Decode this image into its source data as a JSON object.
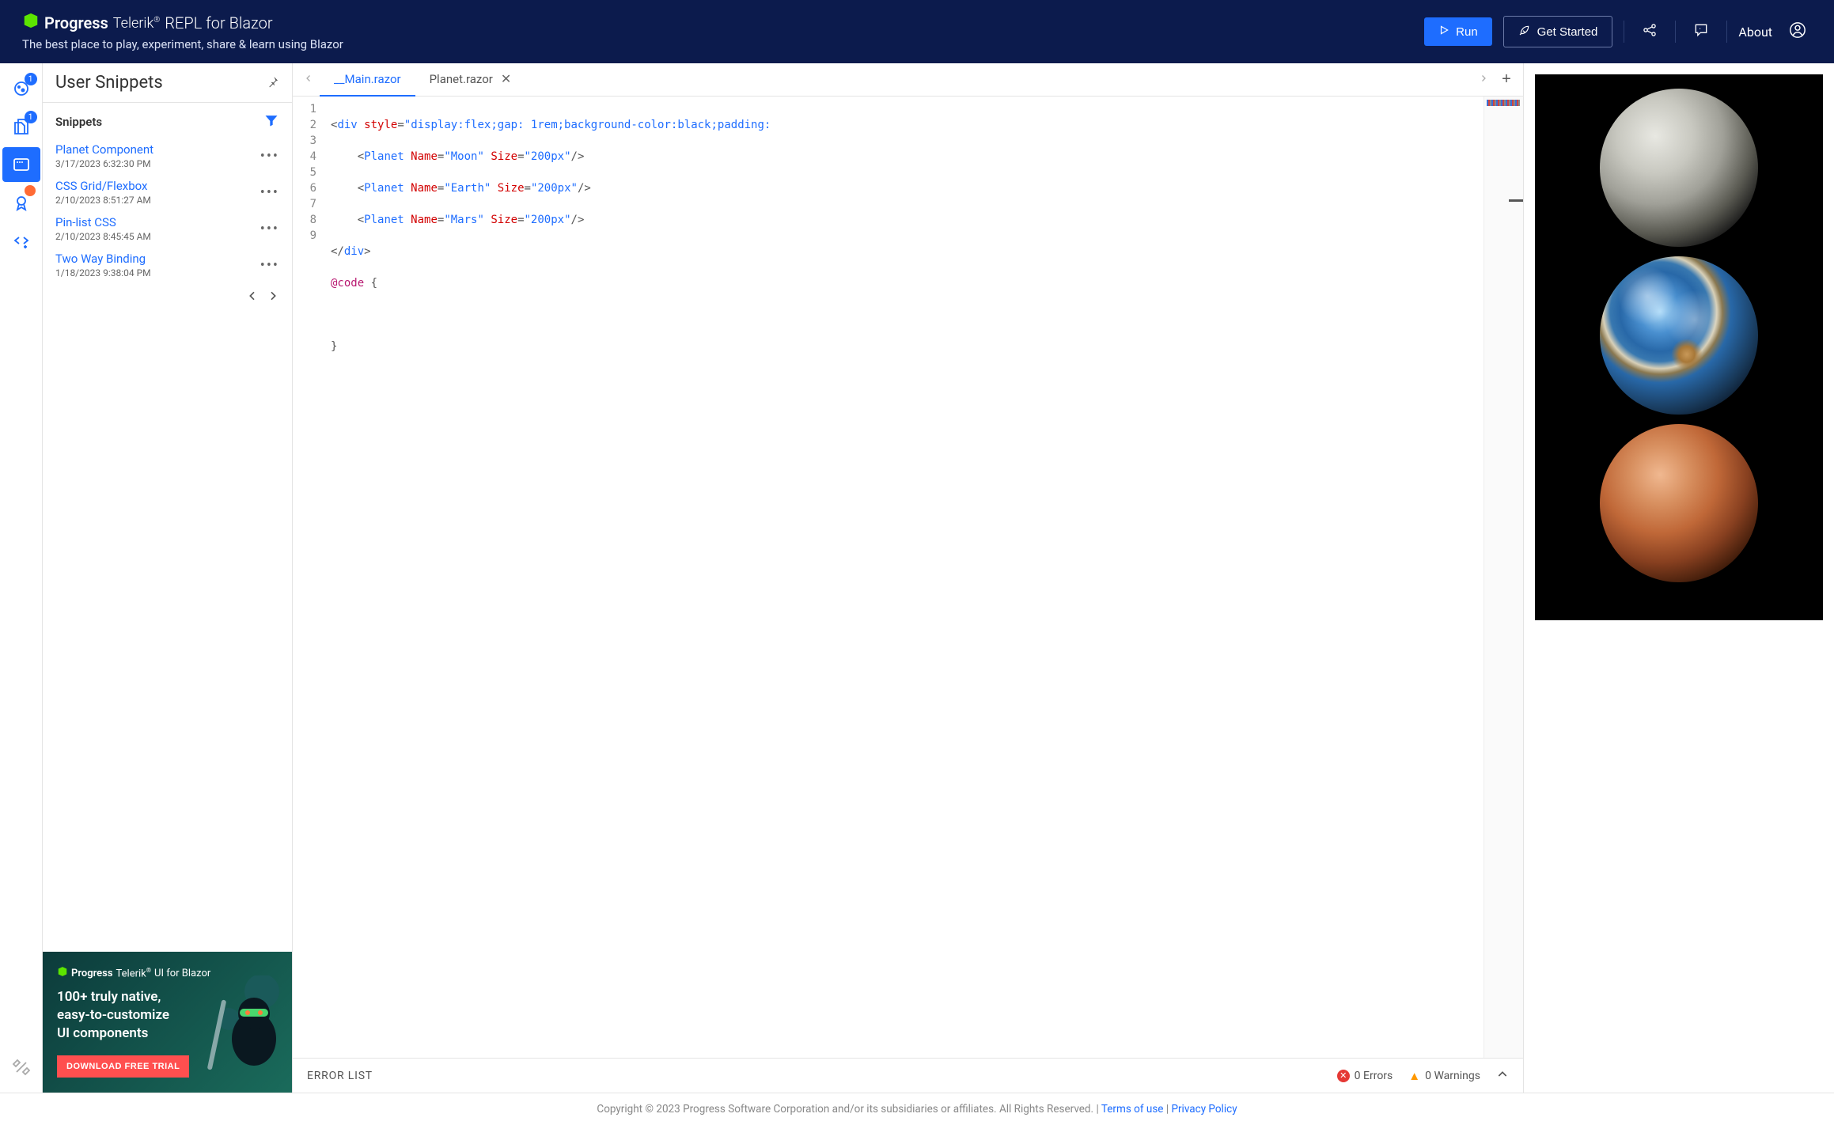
{
  "header": {
    "brand_progress": "Progress",
    "brand_telerik": "Telerik",
    "brand_suffix": "REPL for Blazor",
    "tagline": "The best place to play, experiment, share & learn using Blazor",
    "run_label": "Run",
    "get_started_label": "Get Started",
    "about_label": "About"
  },
  "sidebar": {
    "title": "User Snippets",
    "subtitle": "Snippets",
    "items": [
      {
        "name": "Planet Component",
        "date": "3/17/2023 6:32:30 PM"
      },
      {
        "name": "CSS Grid/Flexbox",
        "date": "2/10/2023 8:51:27 AM"
      },
      {
        "name": "Pin-list CSS",
        "date": "2/10/2023 8:45:45 AM"
      },
      {
        "name": "Two Way Binding",
        "date": "1/18/2023 9:38:04 PM"
      }
    ]
  },
  "rail": {
    "badge1": "1",
    "badge2": "1"
  },
  "promo": {
    "brand_progress": "Progress",
    "brand_telerik": "Telerik",
    "brand_product": "UI for Blazor",
    "heading_l1": "100+ truly native,",
    "heading_l2": "easy-to-customize",
    "heading_l3": "UI components",
    "cta": "DOWNLOAD FREE TRIAL"
  },
  "tabs": {
    "items": [
      {
        "label": "__Main.razor",
        "active": true,
        "closable": false
      },
      {
        "label": "Planet.razor",
        "active": false,
        "closable": true
      }
    ]
  },
  "code": {
    "line_numbers": [
      "1",
      "2",
      "3",
      "4",
      "5",
      "6",
      "7",
      "8",
      "9"
    ],
    "l1_open": "<div",
    "l1_attr_style": "style",
    "l1_style_val": "\"display:flex;gap: 1rem;background-color:black;padding:",
    "l2_tag": "Planet",
    "l2_attr_name": "Name",
    "l2_name_val": "\"Moon\"",
    "l2_attr_size": "Size",
    "l2_size_val": "\"200px\"",
    "l3_name_val": "\"Earth\"",
    "l4_name_val": "\"Mars\"",
    "l5": "</div>",
    "l6_dir": "@code",
    "l6_brace": " {",
    "l8_brace": "}"
  },
  "error_list": {
    "title": "ERROR LIST",
    "errors_count": "0 Errors",
    "warnings_count": "0 Warnings"
  },
  "preview": {
    "planets": [
      "Moon",
      "Earth",
      "Mars"
    ]
  },
  "footer": {
    "copyright": "Copyright © 2023 Progress Software Corporation and/or its subsidiaries or affiliates. All Rights Reserved. | ",
    "terms": "Terms of use",
    "separator": " | ",
    "privacy": "Privacy Policy"
  }
}
